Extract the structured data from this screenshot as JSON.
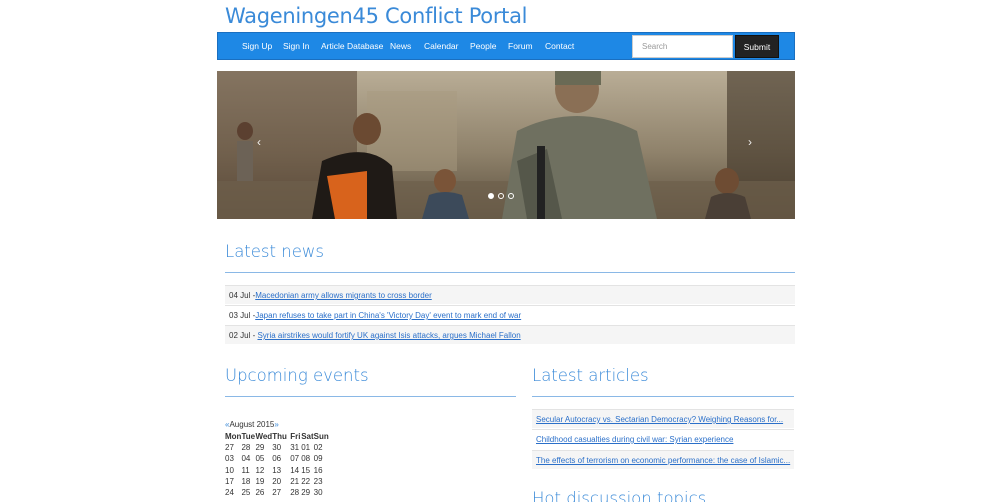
{
  "site": {
    "title": "Wageningen45 Conflict Portal"
  },
  "nav": {
    "items": [
      {
        "label": "Sign Up"
      },
      {
        "label": "Sign In"
      },
      {
        "label": "Article Database"
      },
      {
        "label": "News"
      },
      {
        "label": "Calendar"
      },
      {
        "label": "People"
      },
      {
        "label": "Forum"
      },
      {
        "label": "Contact"
      }
    ],
    "search_placeholder": "Search",
    "submit_label": "Submit"
  },
  "carousel": {
    "prev": "‹",
    "next": "›",
    "slide_count": 3,
    "active_slide": 1
  },
  "latest_news": {
    "heading": "Latest news",
    "items": [
      {
        "date": "04 Jul -",
        "title": "Macedonian army allows migrants to cross border"
      },
      {
        "date": "03 Jul -",
        "title": "Japan refuses to take part in China's 'Victory Day' event to mark end of war"
      },
      {
        "date": "02 Jul - ",
        "title": "Syria airstrikes would fortify UK against Isis attacks, argues Michael Fallon"
      }
    ]
  },
  "upcoming_events": {
    "heading": "Upcoming events",
    "calendar": {
      "prev": "«",
      "month": "August 2015",
      "next": "»",
      "weekdays": [
        "Mon",
        "Tue",
        "Wed",
        "Thu",
        "Fri",
        "Sat",
        "Sun"
      ],
      "weeks": [
        [
          "27",
          "28",
          "29",
          "30",
          "31",
          "01",
          "02"
        ],
        [
          "03",
          "04",
          "05",
          "06",
          "07",
          "08",
          "09"
        ],
        [
          "10",
          "11",
          "12",
          "13",
          "14",
          "15",
          "16"
        ],
        [
          "17",
          "18",
          "19",
          "20",
          "21",
          "22",
          "23"
        ],
        [
          "24",
          "25",
          "26",
          "27",
          "28",
          "29",
          "30"
        ]
      ]
    }
  },
  "latest_articles": {
    "heading": "Latest articles",
    "items": [
      {
        "title": "Secular Autocracy vs. Sectarian Democracy? Weighing Reasons for..."
      },
      {
        "title": "Childhood casualties during civil war: Syrian experience"
      },
      {
        "title": "The effects of terrorism on economic performance: the case of Islamic..."
      }
    ]
  },
  "hot_discussion": {
    "heading": "Hot discussion topics"
  },
  "colors": {
    "brand": "#3a8ad8",
    "navbar": "#1e88e5",
    "link": "#2a6fc9",
    "submit": "#222222"
  }
}
